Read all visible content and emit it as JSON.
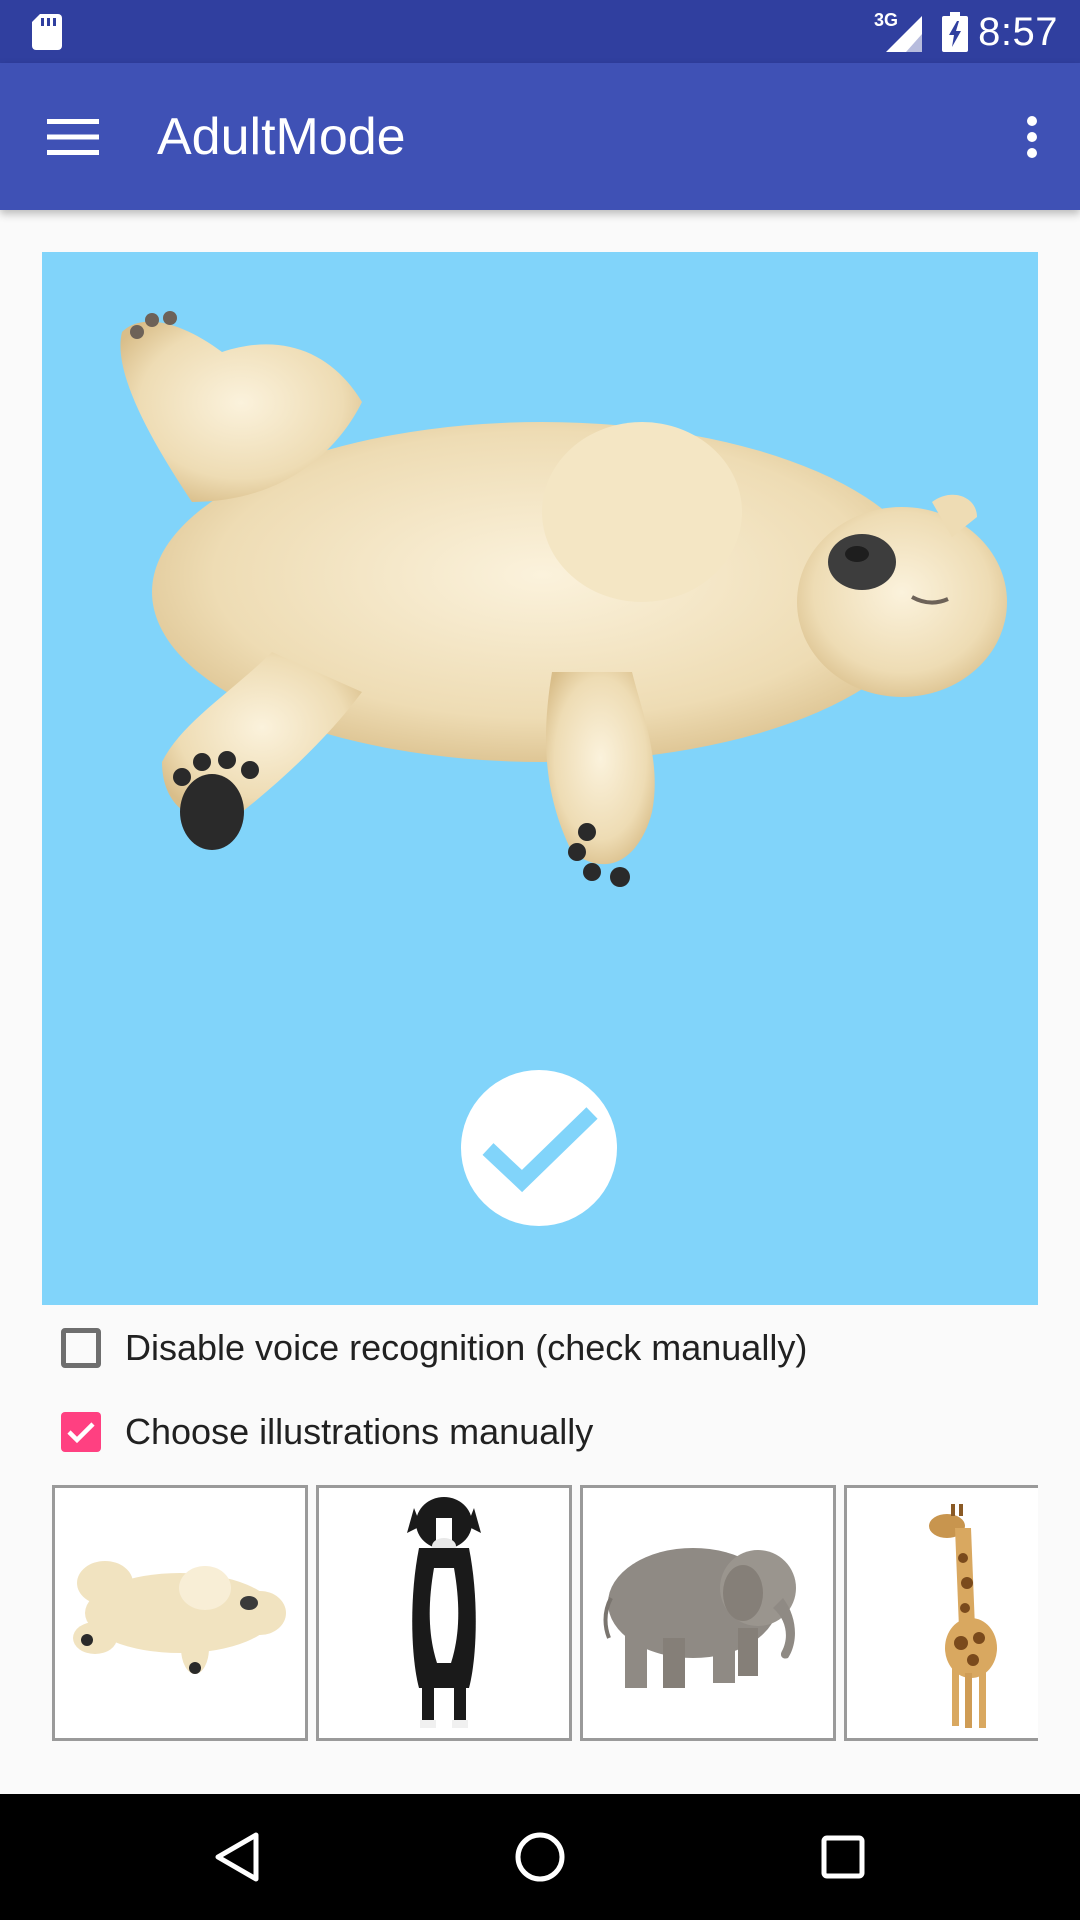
{
  "status_bar": {
    "time": "8:57",
    "network_type": "3G",
    "icons": [
      "sd-card-icon",
      "signal-icon",
      "battery-icon"
    ]
  },
  "app_bar": {
    "title": "AdultMode",
    "navigation_icon": "menu-icon",
    "action_icon": "overflow-menu-icon"
  },
  "preview": {
    "background_color": "#81d4fa",
    "illustration": "polar-bear",
    "confirm_icon": "checkmark-circle-icon"
  },
  "options": {
    "voice": {
      "label": "Disable voice recognition (check manually)",
      "checked": false
    },
    "illustrations": {
      "label": "Choose illustrations manually",
      "checked": true
    }
  },
  "thumbnails": [
    {
      "animal": "polar-bear"
    },
    {
      "animal": "dog"
    },
    {
      "animal": "elephant"
    },
    {
      "animal": "giraffe"
    }
  ],
  "nav_bar": {
    "icons": [
      "back-icon",
      "home-icon",
      "recents-icon"
    ]
  },
  "colors": {
    "status_bar": "#303f9f",
    "app_bar": "#3f51b5",
    "accent": "#ff4081",
    "preview_bg": "#81d4fa"
  }
}
